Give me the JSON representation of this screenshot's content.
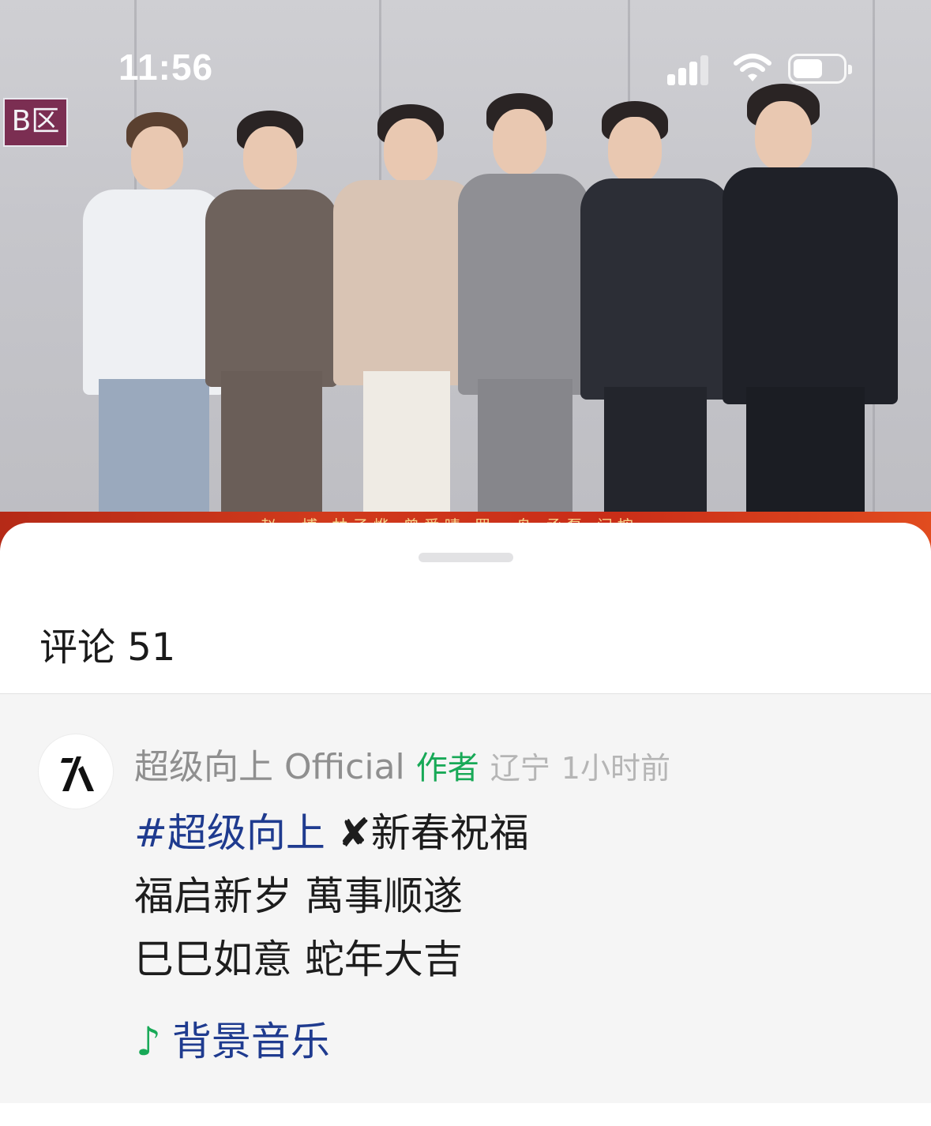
{
  "status_bar": {
    "time": "11:56"
  },
  "video": {
    "zone_sign": "B区",
    "caption_names": "赵一博 林子烨 曾爱晴 罗一舟 丞磊 闫按"
  },
  "sheet": {
    "title": "评论 51"
  },
  "comment": {
    "username": "超级向上 Official",
    "badge": "作者",
    "location": "辽宁",
    "time": "1小时前",
    "topic": "#超级向上",
    "line1_rest": " ✘新春祝福",
    "line2": "福启新岁 萬事顺遂",
    "line3": "巳巳如意 蛇年大吉",
    "music_label": "背景音乐"
  },
  "colors": {
    "badge_green": "#18a957",
    "link_blue": "#1f3b8f",
    "comment_bg": "#f5f5f5"
  }
}
